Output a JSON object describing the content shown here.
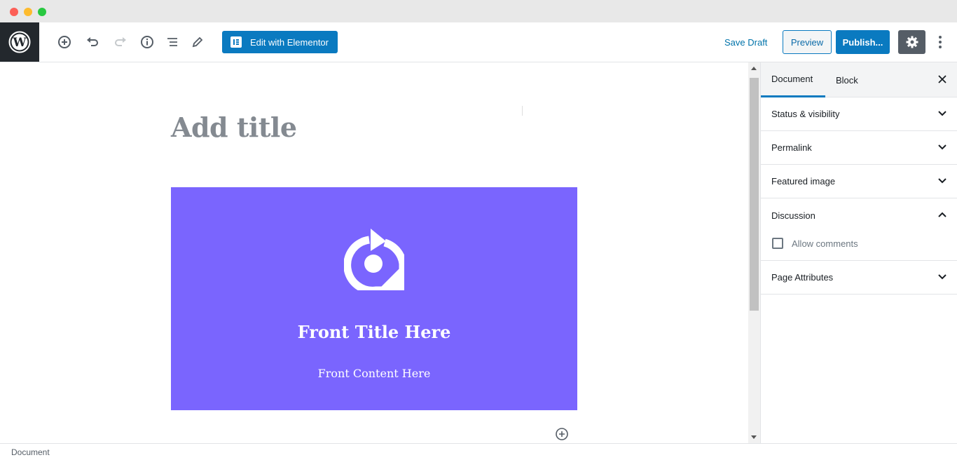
{
  "window": {
    "controls": [
      "close",
      "minimize",
      "maximize"
    ]
  },
  "toolbar": {
    "logo": "wordpress-logo",
    "icons": [
      "add-block-icon",
      "undo-icon",
      "redo-icon",
      "info-icon",
      "block-navigation-icon",
      "edit-pencil-icon"
    ],
    "elementor_label": "Edit with Elementor",
    "save_draft_label": "Save Draft",
    "preview_label": "Preview",
    "publish_label": "Publish...",
    "settings_icon": "gear-icon",
    "more_icon": "more-vertical-icon"
  },
  "editor": {
    "title_placeholder": "Add title",
    "flip_box": {
      "icon": "rotate-pin-icon",
      "title": "Front Title Here",
      "content": "Front Content Here",
      "background": "#7a65fe"
    }
  },
  "sidebar": {
    "tabs": [
      {
        "label": "Document",
        "active": true
      },
      {
        "label": "Block",
        "active": false
      }
    ],
    "panels": [
      {
        "label": "Status & visibility",
        "open": false
      },
      {
        "label": "Permalink",
        "open": false
      },
      {
        "label": "Featured image",
        "open": false
      },
      {
        "label": "Discussion",
        "open": true
      },
      {
        "label": "Page Attributes",
        "open": false
      }
    ],
    "discussion": {
      "allow_comments_label": "Allow comments",
      "allow_comments_checked": false
    }
  },
  "footer": {
    "breadcrumb": "Document"
  },
  "colors": {
    "accent": "#0a7ac0",
    "dark": "#23282d",
    "flip_box": "#7a65fe"
  }
}
